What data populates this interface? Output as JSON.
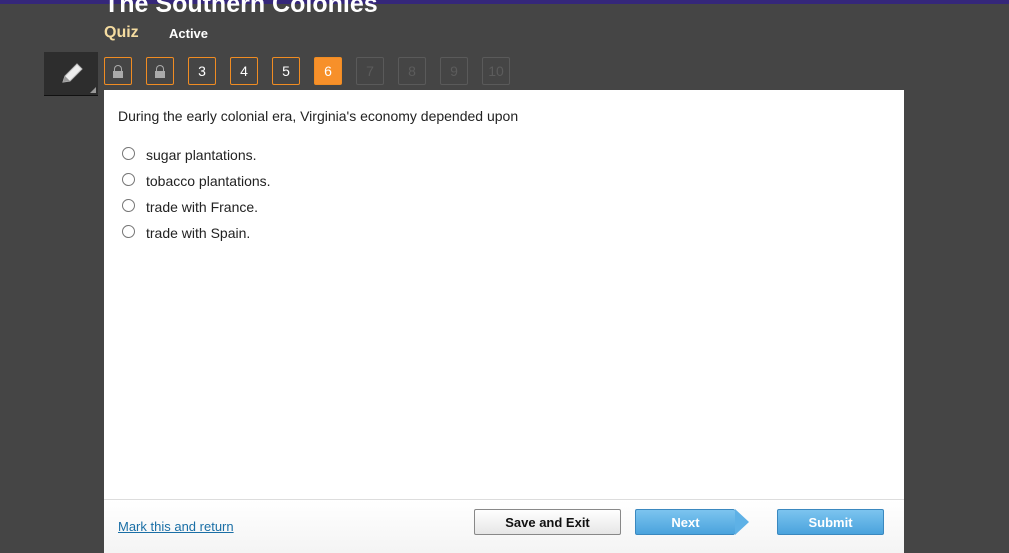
{
  "header": {
    "title": "The Southern Colonies",
    "type": "Quiz",
    "status": "Active"
  },
  "nav": {
    "questions": [
      {
        "label": "",
        "state": "locked"
      },
      {
        "label": "",
        "state": "locked"
      },
      {
        "label": "3",
        "state": "answered"
      },
      {
        "label": "4",
        "state": "answered"
      },
      {
        "label": "5",
        "state": "answered"
      },
      {
        "label": "6",
        "state": "current"
      },
      {
        "label": "7",
        "state": "disabled"
      },
      {
        "label": "8",
        "state": "disabled"
      },
      {
        "label": "9",
        "state": "disabled"
      },
      {
        "label": "10",
        "state": "disabled"
      }
    ]
  },
  "question": {
    "text": "During the early colonial era, Virginia's economy depended upon",
    "options": [
      "sugar plantations.",
      "tobacco plantations.",
      "trade with France.",
      "trade with Spain."
    ]
  },
  "footer": {
    "mark": "Mark this and return",
    "save": "Save and Exit",
    "next": "Next",
    "submit": "Submit"
  },
  "colors": {
    "accent": "#f7902a",
    "button": "#4aa3dd",
    "topbar": "#35277a"
  }
}
